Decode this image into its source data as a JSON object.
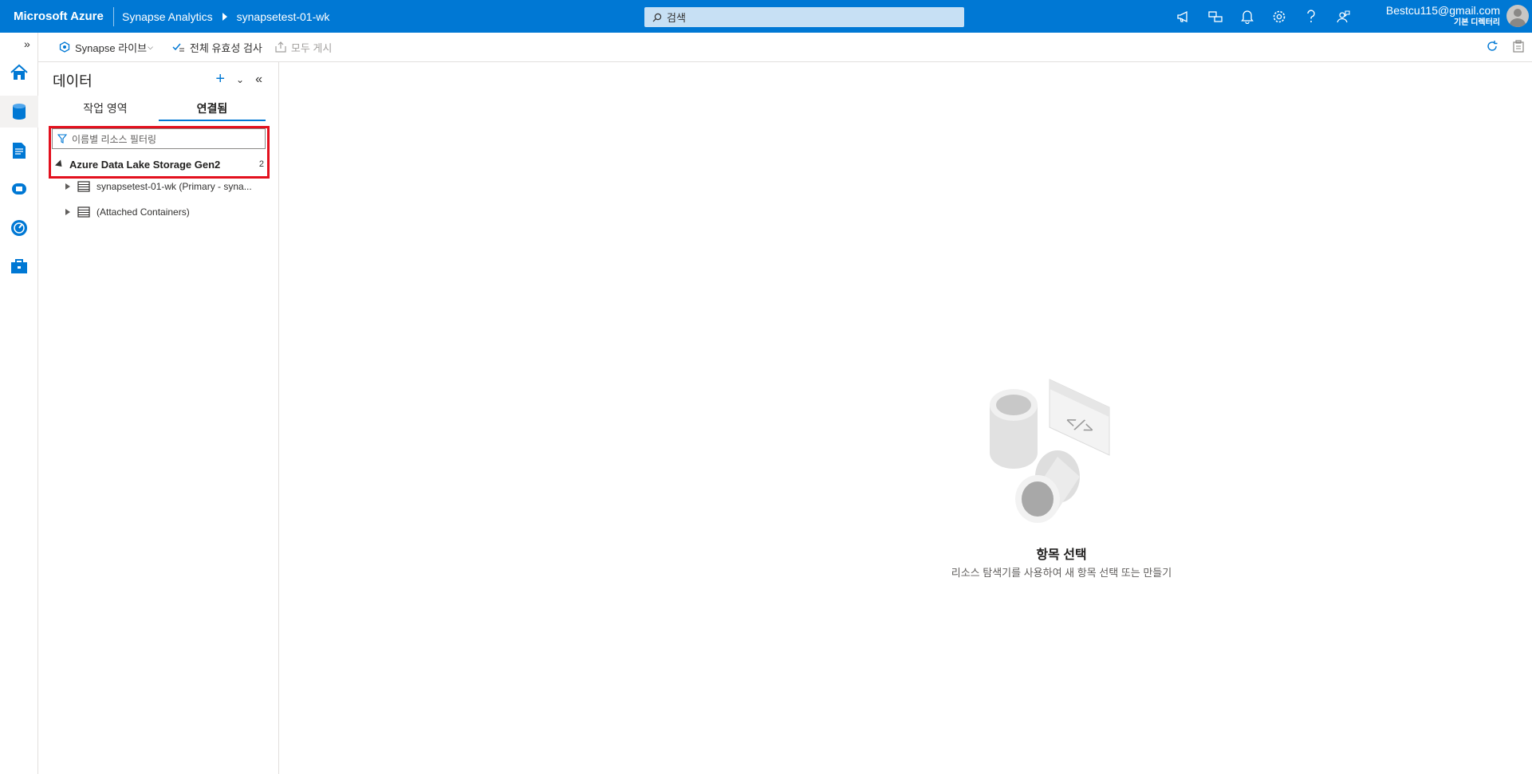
{
  "topbar": {
    "brand": "Microsoft Azure",
    "breadcrumb": [
      "Synapse Analytics",
      "synapsetest-01-wk"
    ],
    "search_placeholder": "검색",
    "account_email": "Bestcu115@gmail.com",
    "account_tenant": "기본 디렉터리"
  },
  "toolbar": {
    "live_mode": "Synapse 라이브",
    "validate_all": "전체 유효성 검사",
    "publish_all": "모두 게시"
  },
  "panel": {
    "title": "데이터",
    "tabs": [
      {
        "label": "작업 영역",
        "active": false
      },
      {
        "label": "연결됨",
        "active": true
      }
    ],
    "filter_placeholder": "이름별 리소스 필터링",
    "group": {
      "label": "Azure Data Lake Storage Gen2",
      "count": "2"
    },
    "items": [
      {
        "label": "synapsetest-01-wk (Primary - syna..."
      },
      {
        "label": "(Attached Containers)"
      }
    ]
  },
  "empty_state": {
    "title": "항목 선택",
    "subtitle": "리소스 탐색기를 사용하여 새 항목 선택 또는 만들기"
  },
  "colors": {
    "brand_blue": "#0078d4",
    "highlight_red": "#e3101e"
  }
}
